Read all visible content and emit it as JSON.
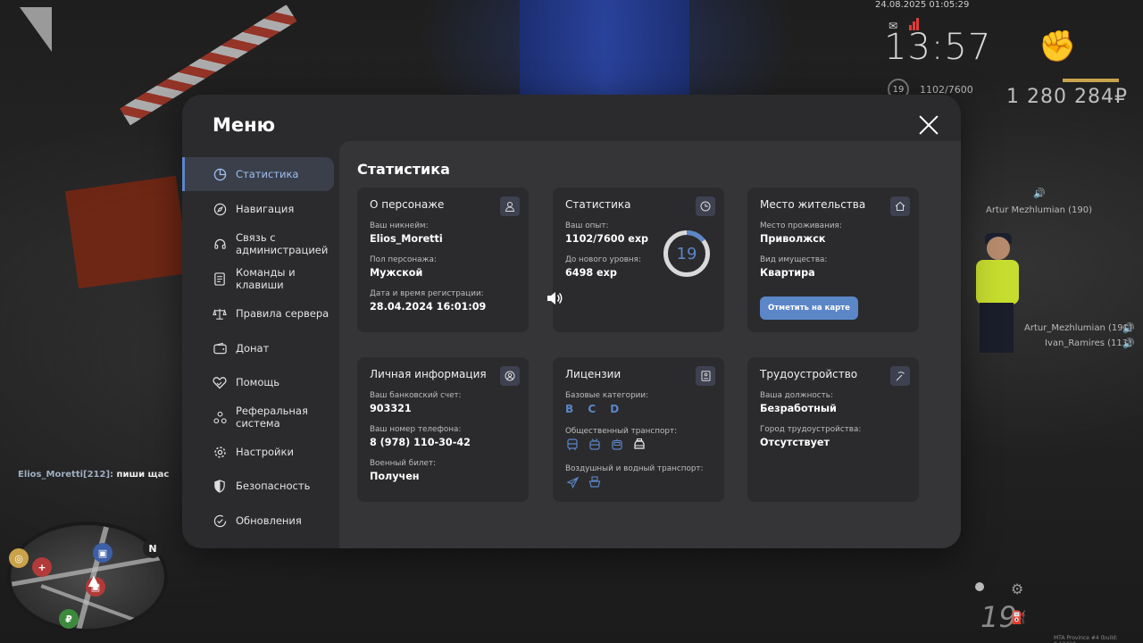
{
  "hud": {
    "datetime": "24.08.2025 01:05:29",
    "time": "13:57",
    "level": "19",
    "exp": "1102/7600",
    "money": "1 280 284₽",
    "speed": "19",
    "build": "MTA Province #4 (build: 0.12410..."
  },
  "world": {
    "name_tag_top": "Artur Mezhlumian (190)",
    "name_tag_1": "Artur_Mezhlumian (190)",
    "name_tag_2": "Ivan_Ramires (113)",
    "chat_name": "Elios_Moretti[212]:",
    "chat_text": "пиши щас",
    "minimap_north": "N"
  },
  "menu": {
    "title": "Меню",
    "nav": [
      {
        "label": "Статистика",
        "icon": "pie-chart-icon",
        "active": true
      },
      {
        "label": "Навигация",
        "icon": "compass-icon"
      },
      {
        "label": "Связь с администрацией",
        "icon": "headset-icon"
      },
      {
        "label": "Команды и клавиши",
        "icon": "document-icon"
      },
      {
        "label": "Правила сервера",
        "icon": "scales-icon"
      },
      {
        "label": "Донат",
        "icon": "wallet-icon"
      },
      {
        "label": "Помощь",
        "icon": "heart-handshake-icon"
      },
      {
        "label": "Реферальная система",
        "icon": "network-icon"
      },
      {
        "label": "Настройки",
        "icon": "gear-icon"
      },
      {
        "label": "Безопасность",
        "icon": "shield-icon"
      },
      {
        "label": "Обновления",
        "icon": "check-circle-icon"
      }
    ]
  },
  "stats": {
    "title": "Статистика",
    "character": {
      "title": "О персонаже",
      "nickname_label": "Ваш никнейм:",
      "nickname": "Elios_Moretti",
      "gender_label": "Пол персонажа:",
      "gender": "Мужской",
      "reg_label": "Дата и время регистрации:",
      "reg": "28.04.2024 16:01:09"
    },
    "statistics": {
      "title": "Статистика",
      "exp_label": "Ваш опыт:",
      "exp": "1102/7600 exp",
      "next_label": "До нового уровня:",
      "next": "6498 exp",
      "level": "19",
      "progress": 0.145
    },
    "residence": {
      "title": "Место жительства",
      "place_label": "Место проживания:",
      "place": "Приволжск",
      "property_label": "Вид имущества:",
      "property": "Квартира",
      "map_button": "Отметить на карте"
    },
    "personal": {
      "title": "Личная информация",
      "bank_label": "Ваш банковский счет:",
      "bank": "903321",
      "phone_label": "Ваш номер телефона:",
      "phone": "8 (978) 110-30-42",
      "military_label": "Военный билет:",
      "military": "Получен"
    },
    "licenses": {
      "title": "Лицензии",
      "base_label": "Базовые категории:",
      "base": "B C D",
      "public_label": "Общественный транспорт:",
      "air_label": "Воздушный и водный транспорт:"
    },
    "employment": {
      "title": "Трудоустройство",
      "position_label": "Ваша должность:",
      "position": "Безработный",
      "city_label": "Город трудоустройства:",
      "city": "Отсутствует"
    }
  },
  "colors": {
    "accent": "#5b86c8",
    "panel": "#2b2b2d",
    "content": "#353537"
  }
}
